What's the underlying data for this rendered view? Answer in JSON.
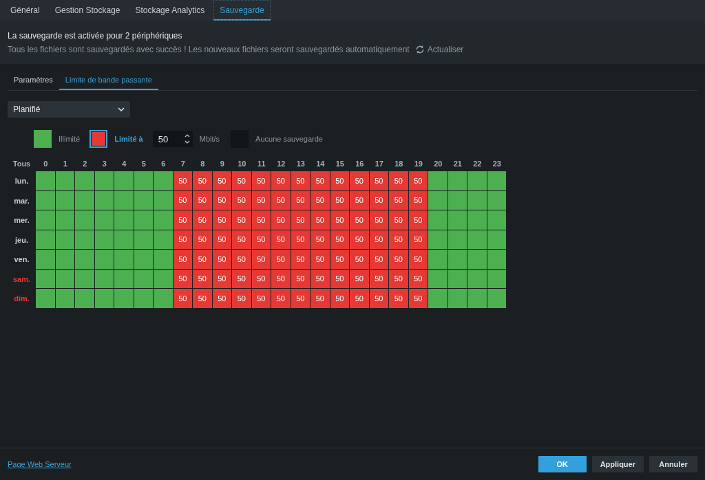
{
  "tabs": [
    {
      "label": "Général",
      "selected": false
    },
    {
      "label": "Gestion Stockage",
      "selected": false
    },
    {
      "label": "Stockage Analytics",
      "selected": false
    },
    {
      "label": "Sauvegarde",
      "selected": true
    }
  ],
  "status": {
    "title": "La sauvegarde est activée pour 2 périphériques",
    "message": "Tous les fichiers sont sauvegardés avec succès ! Les nouveaux fichiers seront sauvegardés automatiquement",
    "refresh": "Actualiser"
  },
  "subtabs": [
    {
      "label": "Paramètres",
      "selected": false
    },
    {
      "label": "Limite de bande passante",
      "selected": true
    }
  ],
  "mode_select": {
    "value": "Planifié"
  },
  "legend": [
    {
      "kind": "unlimited",
      "label": "Illimité",
      "selected": false
    },
    {
      "kind": "limited",
      "label": "Limité à",
      "selected": true,
      "value": "50",
      "unit": "Mbit/s"
    },
    {
      "kind": "none",
      "label": "Aucune sauvegarde",
      "selected": false
    }
  ],
  "schedule": {
    "all_label": "Tous",
    "hours": [
      "0",
      "1",
      "2",
      "3",
      "4",
      "5",
      "6",
      "7",
      "8",
      "9",
      "10",
      "11",
      "12",
      "13",
      "14",
      "15",
      "16",
      "17",
      "18",
      "19",
      "20",
      "21",
      "22",
      "23"
    ],
    "days": [
      {
        "label": "lun.",
        "color": "#c8cdd2",
        "cells": [
          {
            "kind": "unlimited"
          },
          {
            "kind": "unlimited"
          },
          {
            "kind": "unlimited"
          },
          {
            "kind": "unlimited"
          },
          {
            "kind": "unlimited"
          },
          {
            "kind": "unlimited"
          },
          {
            "kind": "unlimited"
          },
          {
            "kind": "limited",
            "text": "50"
          },
          {
            "kind": "limited",
            "text": "50"
          },
          {
            "kind": "limited",
            "text": "50"
          },
          {
            "kind": "limited",
            "text": "50"
          },
          {
            "kind": "limited",
            "text": "50"
          },
          {
            "kind": "limited",
            "text": "50"
          },
          {
            "kind": "limited",
            "text": "50"
          },
          {
            "kind": "limited",
            "text": "50"
          },
          {
            "kind": "limited",
            "text": "50"
          },
          {
            "kind": "limited",
            "text": "50"
          },
          {
            "kind": "limited",
            "text": "50"
          },
          {
            "kind": "limited",
            "text": "50"
          },
          {
            "kind": "limited",
            "text": "50"
          },
          {
            "kind": "unlimited"
          },
          {
            "kind": "unlimited"
          },
          {
            "kind": "unlimited"
          },
          {
            "kind": "unlimited"
          }
        ]
      },
      {
        "label": "mar.",
        "color": "#c8cdd2",
        "cells": [
          {
            "kind": "unlimited"
          },
          {
            "kind": "unlimited"
          },
          {
            "kind": "unlimited"
          },
          {
            "kind": "unlimited"
          },
          {
            "kind": "unlimited"
          },
          {
            "kind": "unlimited"
          },
          {
            "kind": "unlimited"
          },
          {
            "kind": "limited",
            "text": "50"
          },
          {
            "kind": "limited",
            "text": "50"
          },
          {
            "kind": "limited",
            "text": "50"
          },
          {
            "kind": "limited",
            "text": "50"
          },
          {
            "kind": "limited",
            "text": "50"
          },
          {
            "kind": "limited",
            "text": "50"
          },
          {
            "kind": "limited",
            "text": "50"
          },
          {
            "kind": "limited",
            "text": "50"
          },
          {
            "kind": "limited",
            "text": "50"
          },
          {
            "kind": "limited",
            "text": "50"
          },
          {
            "kind": "limited",
            "text": "50"
          },
          {
            "kind": "limited",
            "text": "50"
          },
          {
            "kind": "limited",
            "text": "50"
          },
          {
            "kind": "unlimited"
          },
          {
            "kind": "unlimited"
          },
          {
            "kind": "unlimited"
          },
          {
            "kind": "unlimited"
          }
        ]
      },
      {
        "label": "mer.",
        "color": "#c8cdd2",
        "cells": [
          {
            "kind": "unlimited"
          },
          {
            "kind": "unlimited"
          },
          {
            "kind": "unlimited"
          },
          {
            "kind": "unlimited"
          },
          {
            "kind": "unlimited"
          },
          {
            "kind": "unlimited"
          },
          {
            "kind": "unlimited"
          },
          {
            "kind": "limited",
            "text": "50"
          },
          {
            "kind": "limited",
            "text": "50"
          },
          {
            "kind": "limited",
            "text": "50"
          },
          {
            "kind": "limited",
            "text": "50"
          },
          {
            "kind": "limited",
            "text": "50"
          },
          {
            "kind": "limited",
            "text": "50"
          },
          {
            "kind": "limited",
            "text": "50"
          },
          {
            "kind": "limited",
            "text": "50"
          },
          {
            "kind": "limited",
            "text": "50"
          },
          {
            "kind": "limited",
            "text": "50"
          },
          {
            "kind": "limited",
            "text": "50"
          },
          {
            "kind": "limited",
            "text": "50"
          },
          {
            "kind": "limited",
            "text": "50"
          },
          {
            "kind": "unlimited"
          },
          {
            "kind": "unlimited"
          },
          {
            "kind": "unlimited"
          },
          {
            "kind": "unlimited"
          }
        ]
      },
      {
        "label": "jeu.",
        "color": "#c8cdd2",
        "cells": [
          {
            "kind": "unlimited"
          },
          {
            "kind": "unlimited"
          },
          {
            "kind": "unlimited"
          },
          {
            "kind": "unlimited"
          },
          {
            "kind": "unlimited"
          },
          {
            "kind": "unlimited"
          },
          {
            "kind": "unlimited"
          },
          {
            "kind": "limited",
            "text": "50"
          },
          {
            "kind": "limited",
            "text": "50"
          },
          {
            "kind": "limited",
            "text": "50"
          },
          {
            "kind": "limited",
            "text": "50"
          },
          {
            "kind": "limited",
            "text": "50"
          },
          {
            "kind": "limited",
            "text": "50"
          },
          {
            "kind": "limited",
            "text": "50"
          },
          {
            "kind": "limited",
            "text": "50"
          },
          {
            "kind": "limited",
            "text": "50"
          },
          {
            "kind": "limited",
            "text": "50"
          },
          {
            "kind": "limited",
            "text": "50"
          },
          {
            "kind": "limited",
            "text": "50"
          },
          {
            "kind": "limited",
            "text": "50"
          },
          {
            "kind": "unlimited"
          },
          {
            "kind": "unlimited"
          },
          {
            "kind": "unlimited"
          },
          {
            "kind": "unlimited"
          }
        ]
      },
      {
        "label": "ven.",
        "color": "#c8cdd2",
        "cells": [
          {
            "kind": "unlimited"
          },
          {
            "kind": "unlimited"
          },
          {
            "kind": "unlimited"
          },
          {
            "kind": "unlimited"
          },
          {
            "kind": "unlimited"
          },
          {
            "kind": "unlimited"
          },
          {
            "kind": "unlimited"
          },
          {
            "kind": "limited",
            "text": "50"
          },
          {
            "kind": "limited",
            "text": "50"
          },
          {
            "kind": "limited",
            "text": "50"
          },
          {
            "kind": "limited",
            "text": "50"
          },
          {
            "kind": "limited",
            "text": "50"
          },
          {
            "kind": "limited",
            "text": "50"
          },
          {
            "kind": "limited",
            "text": "50"
          },
          {
            "kind": "limited",
            "text": "50"
          },
          {
            "kind": "limited",
            "text": "50"
          },
          {
            "kind": "limited",
            "text": "50"
          },
          {
            "kind": "limited",
            "text": "50"
          },
          {
            "kind": "limited",
            "text": "50"
          },
          {
            "kind": "limited",
            "text": "50"
          },
          {
            "kind": "unlimited"
          },
          {
            "kind": "unlimited"
          },
          {
            "kind": "unlimited"
          },
          {
            "kind": "unlimited"
          }
        ]
      },
      {
        "label": "sam.",
        "color": "#e53935",
        "cells": [
          {
            "kind": "unlimited"
          },
          {
            "kind": "unlimited"
          },
          {
            "kind": "unlimited"
          },
          {
            "kind": "unlimited"
          },
          {
            "kind": "unlimited"
          },
          {
            "kind": "unlimited"
          },
          {
            "kind": "unlimited"
          },
          {
            "kind": "limited",
            "text": "50"
          },
          {
            "kind": "limited",
            "text": "50"
          },
          {
            "kind": "limited",
            "text": "50"
          },
          {
            "kind": "limited",
            "text": "50"
          },
          {
            "kind": "limited",
            "text": "50"
          },
          {
            "kind": "limited",
            "text": "50"
          },
          {
            "kind": "limited",
            "text": "50"
          },
          {
            "kind": "limited",
            "text": "50"
          },
          {
            "kind": "limited",
            "text": "50"
          },
          {
            "kind": "limited",
            "text": "50"
          },
          {
            "kind": "limited",
            "text": "50"
          },
          {
            "kind": "limited",
            "text": "50"
          },
          {
            "kind": "limited",
            "text": "50"
          },
          {
            "kind": "unlimited"
          },
          {
            "kind": "unlimited"
          },
          {
            "kind": "unlimited"
          },
          {
            "kind": "unlimited"
          }
        ]
      },
      {
        "label": "dim.",
        "color": "#e53935",
        "cells": [
          {
            "kind": "unlimited"
          },
          {
            "kind": "unlimited"
          },
          {
            "kind": "unlimited"
          },
          {
            "kind": "unlimited"
          },
          {
            "kind": "unlimited"
          },
          {
            "kind": "unlimited"
          },
          {
            "kind": "unlimited"
          },
          {
            "kind": "limited",
            "text": "50"
          },
          {
            "kind": "limited",
            "text": "50"
          },
          {
            "kind": "limited",
            "text": "50"
          },
          {
            "kind": "limited",
            "text": "50"
          },
          {
            "kind": "limited",
            "text": "50"
          },
          {
            "kind": "limited",
            "text": "50"
          },
          {
            "kind": "limited",
            "text": "50"
          },
          {
            "kind": "limited",
            "text": "50"
          },
          {
            "kind": "limited",
            "text": "50"
          },
          {
            "kind": "limited",
            "text": "50"
          },
          {
            "kind": "limited",
            "text": "50"
          },
          {
            "kind": "limited",
            "text": "50"
          },
          {
            "kind": "limited",
            "text": "50"
          },
          {
            "kind": "unlimited"
          },
          {
            "kind": "unlimited"
          },
          {
            "kind": "unlimited"
          },
          {
            "kind": "unlimited"
          }
        ]
      }
    ]
  },
  "footer": {
    "link": "Page Web Serveur",
    "buttons": [
      {
        "label": "OK",
        "kind": "primary"
      },
      {
        "label": "Appliquer",
        "kind": "secondary"
      },
      {
        "label": "Annuler",
        "kind": "secondary"
      }
    ]
  }
}
